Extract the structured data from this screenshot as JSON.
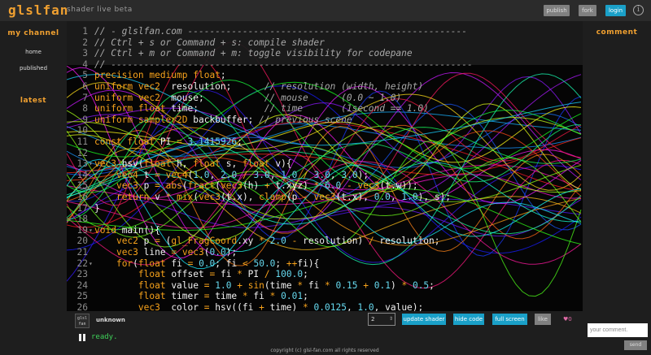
{
  "header": {
    "logo": "glslfan",
    "tagline": "shader live beta",
    "publish_label": "publish",
    "fork_label": "fork",
    "login_label": "login",
    "info_icon": "i"
  },
  "sidebar": {
    "my_channel": "my channel",
    "items": [
      {
        "label": "home"
      },
      {
        "label": "published"
      }
    ],
    "latest": "latest"
  },
  "comments": {
    "heading": "comment",
    "placeholder": "your comment.",
    "send_label": "send"
  },
  "editor": {
    "lines": [
      {
        "n": "1",
        "fold": "",
        "segs": [
          [
            "com",
            "// - glslfan.com ---------------------------------------------------"
          ]
        ]
      },
      {
        "n": "2",
        "fold": "",
        "segs": [
          [
            "com",
            "// Ctrl + s or Command + s: compile shader"
          ]
        ]
      },
      {
        "n": "3",
        "fold": "",
        "segs": [
          [
            "com",
            "// Ctrl + m or Command + m: toggle visibility for codepane"
          ]
        ]
      },
      {
        "n": "4",
        "fold": "",
        "segs": [
          [
            "com",
            "// ------------------------------------------------------------------"
          ]
        ]
      },
      {
        "n": "5",
        "fold": "",
        "segs": [
          [
            "kw",
            "precision mediump float"
          ],
          [
            "pl",
            ";"
          ]
        ]
      },
      {
        "n": "6",
        "fold": "",
        "segs": [
          [
            "kw",
            "uniform vec2"
          ],
          [
            "pl",
            "  resolution;      "
          ],
          [
            "com",
            "// resolution (width, height)"
          ]
        ]
      },
      {
        "n": "7",
        "fold": "",
        "segs": [
          [
            "kw",
            "uniform vec2"
          ],
          [
            "pl",
            "  mouse;           "
          ],
          [
            "com",
            "// mouse      (0.0 ~ 1.0)"
          ]
        ]
      },
      {
        "n": "8",
        "fold": "",
        "segs": [
          [
            "kw",
            "uniform float"
          ],
          [
            "pl",
            " time;            "
          ],
          [
            "com",
            "// time       (1second == 1.0)"
          ]
        ]
      },
      {
        "n": "9",
        "fold": "",
        "segs": [
          [
            "kw",
            "uniform sampler2D"
          ],
          [
            "pl",
            " backbuffer; "
          ],
          [
            "com",
            "// previous scene"
          ]
        ]
      },
      {
        "n": "10",
        "fold": "",
        "segs": [
          [
            "pl",
            ""
          ]
        ]
      },
      {
        "n": "11",
        "fold": "",
        "segs": [
          [
            "kw",
            "const float"
          ],
          [
            "pl",
            " PI "
          ],
          [
            "op",
            "="
          ],
          [
            "pl",
            " "
          ],
          [
            "num",
            "3.1415926"
          ],
          [
            "pl",
            ";"
          ]
        ]
      },
      {
        "n": "12",
        "fold": "",
        "segs": [
          [
            "pl",
            ""
          ]
        ]
      },
      {
        "n": "13",
        "fold": "▾",
        "segs": [
          [
            "kw",
            "vec3"
          ],
          [
            "pl",
            " hsv("
          ],
          [
            "kw",
            "float"
          ],
          [
            "pl",
            " h, "
          ],
          [
            "kw",
            "float"
          ],
          [
            "pl",
            " s, "
          ],
          [
            "kw",
            "float"
          ],
          [
            "pl",
            " v){"
          ]
        ]
      },
      {
        "n": "14",
        "fold": "",
        "segs": [
          [
            "pl",
            "    "
          ],
          [
            "kw",
            "vec4"
          ],
          [
            "pl",
            " t "
          ],
          [
            "op",
            "="
          ],
          [
            "pl",
            " "
          ],
          [
            "fn",
            "vec4"
          ],
          [
            "pl",
            "("
          ],
          [
            "num",
            "1.0"
          ],
          [
            "pl",
            ", "
          ],
          [
            "num",
            "2.0"
          ],
          [
            "pl",
            " "
          ],
          [
            "op",
            "/"
          ],
          [
            "pl",
            " "
          ],
          [
            "num",
            "3.0"
          ],
          [
            "pl",
            ", "
          ],
          [
            "num",
            "1.0"
          ],
          [
            "pl",
            " "
          ],
          [
            "op",
            "/"
          ],
          [
            "pl",
            " "
          ],
          [
            "num",
            "3.0"
          ],
          [
            "pl",
            ", "
          ],
          [
            "num",
            "3.0"
          ],
          [
            "pl",
            ");"
          ]
        ]
      },
      {
        "n": "15",
        "fold": "",
        "segs": [
          [
            "pl",
            "    "
          ],
          [
            "kw",
            "vec3"
          ],
          [
            "pl",
            " p "
          ],
          [
            "op",
            "="
          ],
          [
            "pl",
            " "
          ],
          [
            "fn",
            "abs"
          ],
          [
            "pl",
            "("
          ],
          [
            "fn",
            "fract"
          ],
          [
            "pl",
            "("
          ],
          [
            "fn",
            "vec3"
          ],
          [
            "pl",
            "(h) "
          ],
          [
            "op",
            "+"
          ],
          [
            "pl",
            " t.xyz) "
          ],
          [
            "op",
            "*"
          ],
          [
            "pl",
            " "
          ],
          [
            "num",
            "6.0"
          ],
          [
            "pl",
            " "
          ],
          [
            "op",
            "-"
          ],
          [
            "pl",
            " "
          ],
          [
            "fn",
            "vec3"
          ],
          [
            "pl",
            "(t.w));"
          ]
        ]
      },
      {
        "n": "16",
        "fold": "",
        "segs": [
          [
            "pl",
            "    "
          ],
          [
            "kw",
            "return"
          ],
          [
            "pl",
            " v "
          ],
          [
            "op",
            "*"
          ],
          [
            "pl",
            " "
          ],
          [
            "fn",
            "mix"
          ],
          [
            "pl",
            "("
          ],
          [
            "fn",
            "vec3"
          ],
          [
            "pl",
            "(t.x), "
          ],
          [
            "fn",
            "clamp"
          ],
          [
            "pl",
            "(p "
          ],
          [
            "op",
            "-"
          ],
          [
            "pl",
            " "
          ],
          [
            "fn",
            "vec3"
          ],
          [
            "pl",
            "(t.x), "
          ],
          [
            "num",
            "0.0"
          ],
          [
            "pl",
            ", "
          ],
          [
            "num",
            "1.0"
          ],
          [
            "pl",
            "), s);"
          ]
        ]
      },
      {
        "n": "17",
        "fold": "",
        "segs": [
          [
            "pl",
            "}"
          ]
        ]
      },
      {
        "n": "18",
        "fold": "",
        "segs": [
          [
            "pl",
            ""
          ]
        ]
      },
      {
        "n": "19",
        "fold": "▾",
        "segs": [
          [
            "kw",
            "void"
          ],
          [
            "pl",
            " main(){"
          ]
        ]
      },
      {
        "n": "20",
        "fold": "",
        "segs": [
          [
            "pl",
            "    "
          ],
          [
            "kw",
            "vec2"
          ],
          [
            "pl",
            " p "
          ],
          [
            "op",
            "="
          ],
          [
            "pl",
            " ("
          ],
          [
            "fn",
            "gl_FragCoord"
          ],
          [
            "pl",
            ".xy "
          ],
          [
            "op",
            "*"
          ],
          [
            "pl",
            " "
          ],
          [
            "num",
            "2.0"
          ],
          [
            "pl",
            " "
          ],
          [
            "op",
            "-"
          ],
          [
            "pl",
            " resolution) "
          ],
          [
            "op",
            "/"
          ],
          [
            "pl",
            " resolution;"
          ]
        ]
      },
      {
        "n": "21",
        "fold": "",
        "segs": [
          [
            "pl",
            "    "
          ],
          [
            "kw",
            "vec3"
          ],
          [
            "pl",
            " line "
          ],
          [
            "op",
            "="
          ],
          [
            "pl",
            " "
          ],
          [
            "fn",
            "vec3"
          ],
          [
            "pl",
            "("
          ],
          [
            "num",
            "0.0"
          ],
          [
            "pl",
            ");"
          ]
        ]
      },
      {
        "n": "22",
        "fold": "▾",
        "segs": [
          [
            "pl",
            "    "
          ],
          [
            "kw",
            "for"
          ],
          [
            "pl",
            "("
          ],
          [
            "kw",
            "float"
          ],
          [
            "pl",
            " fi "
          ],
          [
            "op",
            "="
          ],
          [
            "pl",
            " "
          ],
          [
            "num",
            "0.0"
          ],
          [
            "pl",
            "; fi "
          ],
          [
            "op",
            "<"
          ],
          [
            "pl",
            " "
          ],
          [
            "num",
            "50.0"
          ],
          [
            "pl",
            "; "
          ],
          [
            "op",
            "++"
          ],
          [
            "pl",
            "fi){"
          ]
        ]
      },
      {
        "n": "23",
        "fold": "",
        "segs": [
          [
            "pl",
            "        "
          ],
          [
            "kw",
            "float"
          ],
          [
            "pl",
            " offset "
          ],
          [
            "op",
            "="
          ],
          [
            "pl",
            " fi "
          ],
          [
            "op",
            "*"
          ],
          [
            "pl",
            " PI "
          ],
          [
            "op",
            "/"
          ],
          [
            "pl",
            " "
          ],
          [
            "num",
            "100.0"
          ],
          [
            "pl",
            ";"
          ]
        ]
      },
      {
        "n": "24",
        "fold": "",
        "segs": [
          [
            "pl",
            "        "
          ],
          [
            "kw",
            "float"
          ],
          [
            "pl",
            " value "
          ],
          [
            "op",
            "="
          ],
          [
            "pl",
            " "
          ],
          [
            "num",
            "1.0"
          ],
          [
            "pl",
            " "
          ],
          [
            "op",
            "+"
          ],
          [
            "pl",
            " "
          ],
          [
            "fn",
            "sin"
          ],
          [
            "pl",
            "(time "
          ],
          [
            "op",
            "*"
          ],
          [
            "pl",
            " fi "
          ],
          [
            "op",
            "*"
          ],
          [
            "pl",
            " "
          ],
          [
            "num",
            "0.15"
          ],
          [
            "pl",
            " "
          ],
          [
            "op",
            "+"
          ],
          [
            "pl",
            " "
          ],
          [
            "num",
            "0.1"
          ],
          [
            "pl",
            ") "
          ],
          [
            "op",
            "*"
          ],
          [
            "pl",
            " "
          ],
          [
            "num",
            "0.5"
          ],
          [
            "pl",
            ";"
          ]
        ]
      },
      {
        "n": "25",
        "fold": "",
        "segs": [
          [
            "pl",
            "        "
          ],
          [
            "kw",
            "float"
          ],
          [
            "pl",
            " timer "
          ],
          [
            "op",
            "="
          ],
          [
            "pl",
            " time "
          ],
          [
            "op",
            "*"
          ],
          [
            "pl",
            " fi "
          ],
          [
            "op",
            "*"
          ],
          [
            "pl",
            " "
          ],
          [
            "num",
            "0.01"
          ],
          [
            "pl",
            ";"
          ]
        ]
      },
      {
        "n": "26",
        "fold": "",
        "segs": [
          [
            "pl",
            "        "
          ],
          [
            "kw",
            "vec3"
          ],
          [
            "pl",
            "  color "
          ],
          [
            "op",
            "="
          ],
          [
            "pl",
            " hsv((fi "
          ],
          [
            "op",
            "+"
          ],
          [
            "pl",
            " time) "
          ],
          [
            "op",
            "*"
          ],
          [
            "pl",
            " "
          ],
          [
            "num",
            "0.0125"
          ],
          [
            "pl",
            ", "
          ],
          [
            "num",
            "1.0"
          ],
          [
            "pl",
            ", value);"
          ]
        ]
      }
    ]
  },
  "bottom": {
    "avatar_text": "glsl fan",
    "author": "unknown",
    "page_value": "2",
    "update_label": "update shader",
    "hide_label": "hide code",
    "full_label": "full screen",
    "like_label": "like",
    "like_count": "♥0",
    "status": "ready.",
    "copyright": "copyright (c) glsl-fan.com all rights reserved"
  },
  "colors": {
    "accent_orange": "#f0a030",
    "accent_blue": "#1aa0c8",
    "status_green": "#3fd25a",
    "like_pink": "#e06aa6"
  },
  "icons": [
    "info-icon",
    "fold-arrow-icon",
    "pause-icon",
    "heart-icon",
    "select-arrows-icon"
  ]
}
